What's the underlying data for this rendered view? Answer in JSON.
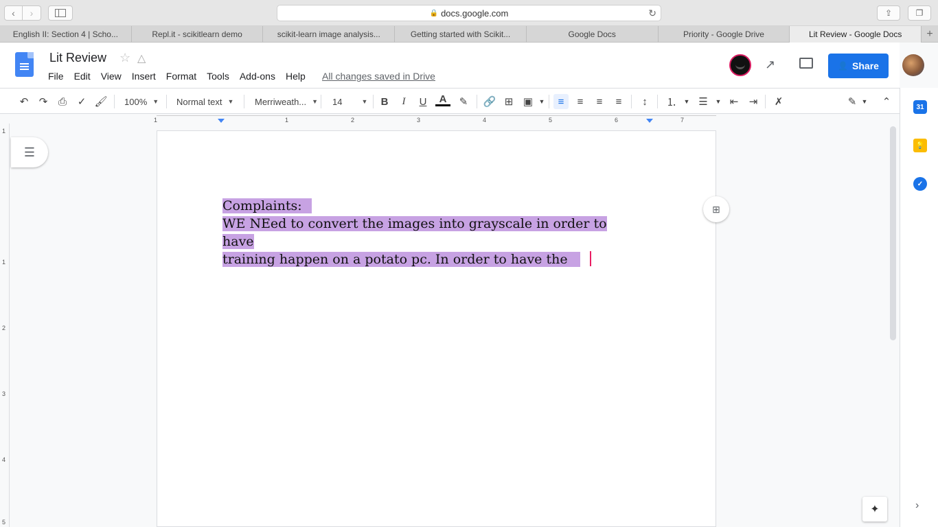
{
  "browser": {
    "url": "docs.google.com",
    "tabs": [
      "English II: Section 4 | Scho...",
      "Repl.it - scikitlearn demo",
      "scikit-learn image analysis...",
      "Getting started with Scikit...",
      "Google Docs",
      "Priority - Google Drive",
      "Lit Review - Google Docs"
    ],
    "new_tab": "+"
  },
  "docs": {
    "title": "Lit Review",
    "menu": [
      "File",
      "Edit",
      "View",
      "Insert",
      "Format",
      "Tools",
      "Add-ons",
      "Help"
    ],
    "saved_status": "All changes saved in Drive",
    "share_label": "Share"
  },
  "toolbar": {
    "zoom": "100%",
    "style": "Normal text",
    "font": "Merriweath...",
    "font_size": "14",
    "bold": "B",
    "italic": "I",
    "underline": "U",
    "text_color": "A"
  },
  "ruler": {
    "numbers": [
      "1",
      "1",
      "2",
      "3",
      "4",
      "5",
      "6",
      "7"
    ],
    "vnumbers": [
      "1",
      "1",
      "2",
      "3",
      "4",
      "5"
    ]
  },
  "side_panel": {
    "calendar_day": "31"
  },
  "document": {
    "line1": "Complaints:",
    "line2": "WE NEed to convert the images into grayscale in order to have",
    "line3": "training happen on a potato pc. In order to have the"
  },
  "colors": {
    "accent": "#1a73e8",
    "selection": "#c7a2e3",
    "cursor": "#e91e63"
  }
}
